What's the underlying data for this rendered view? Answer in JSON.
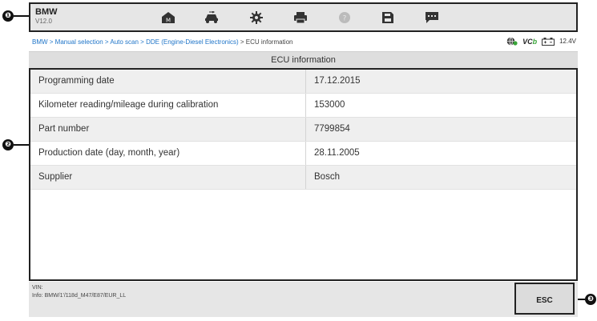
{
  "callouts": [
    "❶",
    "❷",
    "❸"
  ],
  "app": {
    "name": "BMW",
    "version": "V12.0"
  },
  "toolbar": {
    "buttons": [
      {
        "icon": "home-icon"
      },
      {
        "icon": "vehicle-swap-icon"
      },
      {
        "icon": "settings-gear-icon"
      },
      {
        "icon": "print-icon"
      },
      {
        "icon": "help-icon"
      },
      {
        "icon": "save-icon"
      },
      {
        "icon": "message-icon"
      }
    ]
  },
  "breadcrumb": {
    "path": "BMW > Manual selection > Auto scan > DDE (Engine-Diesel Electronics)",
    "current": " > ECU information"
  },
  "status": {
    "vci": "VC",
    "vci_b": "b",
    "voltage": "12.4V"
  },
  "section": {
    "title": "ECU information"
  },
  "table": {
    "rows": [
      {
        "label": "Programming date",
        "value": "17.12.2015"
      },
      {
        "label": "Kilometer reading/mileage during calibration",
        "value": "153000"
      },
      {
        "label": "Part number",
        "value": "7799854"
      },
      {
        "label": "Production date (day, month, year)",
        "value": "28.11.2005"
      },
      {
        "label": "Supplier",
        "value": "Bosch"
      }
    ]
  },
  "footer": {
    "vin_label": "VIN:",
    "info": "Info: BMW/1'/118d_M47/E87/EUR_LL",
    "esc_label": "ESC"
  },
  "colors": {
    "link": "#1e74c8",
    "toolbar_bg": "#e6e6e6",
    "alt_row": "#efefef"
  }
}
